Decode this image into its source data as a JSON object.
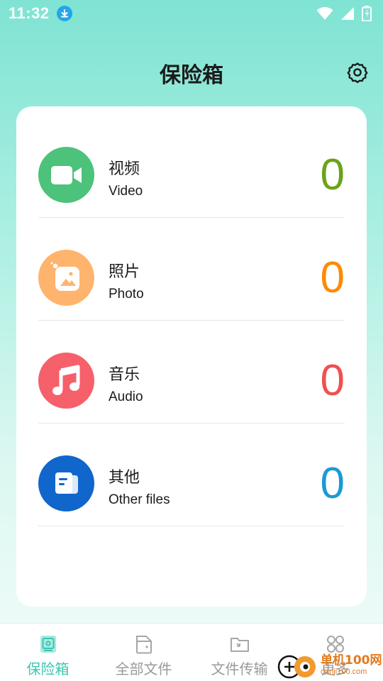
{
  "status_bar": {
    "time": "11:32"
  },
  "header": {
    "title": "保险箱"
  },
  "categories": [
    {
      "name_cn": "视频",
      "name_en": "Video",
      "count": "0",
      "icon": "video-camera-icon",
      "circle_color": "#4cc27a",
      "count_color": "#6aa319"
    },
    {
      "name_cn": "照片",
      "name_en": "Photo",
      "count": "0",
      "icon": "photo-icon",
      "circle_color": "#ffb46e",
      "count_color": "#ff8a00"
    },
    {
      "name_cn": "音乐",
      "name_en": "Audio",
      "count": "0",
      "icon": "music-note-icon",
      "circle_color": "#f6606a",
      "count_color": "#f05050"
    },
    {
      "name_cn": "其他",
      "name_en": "Other files",
      "count": "0",
      "icon": "document-icon",
      "circle_color": "#1166cc",
      "count_color": "#1a9ad6"
    }
  ],
  "bottom_nav": {
    "items": [
      {
        "label": "保险箱",
        "icon": "safe-box-icon",
        "active": true
      },
      {
        "label": "全部文件",
        "icon": "folder-file-icon",
        "active": false
      },
      {
        "label": "文件传输",
        "icon": "file-transfer-icon",
        "active": false
      },
      {
        "label": "更多",
        "icon": "more-grid-icon",
        "active": false
      }
    ]
  },
  "watermark": {
    "line1": "单机100网",
    "line2": "danji100.com"
  },
  "colors": {
    "accent": "#3cc6b0",
    "nav_inactive": "#9a9a9a"
  }
}
